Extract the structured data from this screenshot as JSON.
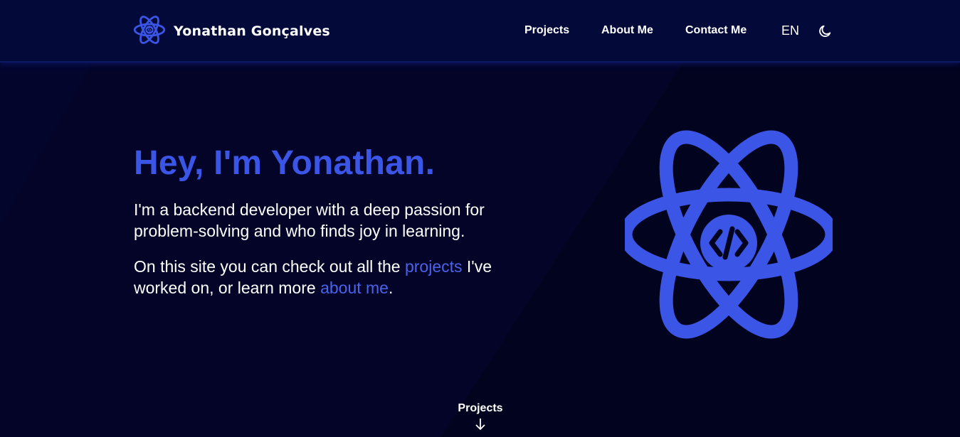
{
  "colors": {
    "background": "#02031e",
    "navbar": "#030a3a",
    "accent": "#3b55e6",
    "link": "#4a63ea",
    "text": "#ffffff"
  },
  "header": {
    "brand_name": "Yonathan Gonçalves",
    "logo_icon": "atom-code-icon",
    "nav": [
      {
        "label": "Projects"
      },
      {
        "label": "About Me"
      },
      {
        "label": "Contact Me"
      }
    ],
    "language": "EN",
    "theme_icon": "moon-icon"
  },
  "hero": {
    "title": "Hey, I'm Yonathan.",
    "intro": "I'm a backend developer with a deep passion for problem-solving and who finds joy in learning.",
    "line2_before": "On this site you can check out all the ",
    "projects_link": "projects",
    "line2_middle": " I've worked on, or learn more ",
    "about_link": "about me",
    "line2_after": ".",
    "illustration_icon": "atom-code-icon"
  },
  "scroll_cue": {
    "label": "Projects",
    "icon": "arrow-down-icon"
  }
}
